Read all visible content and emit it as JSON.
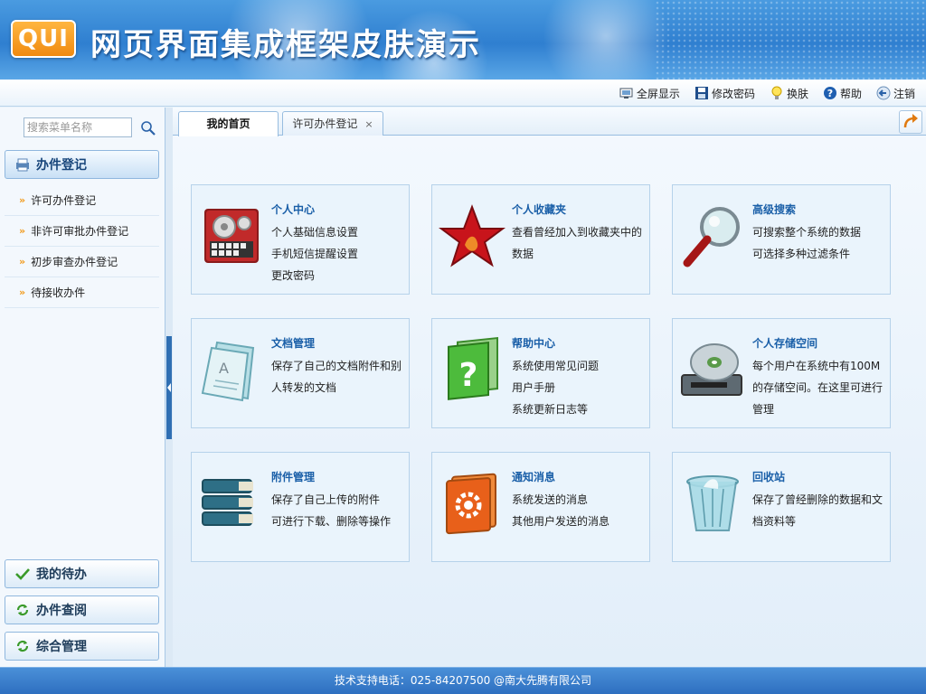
{
  "header": {
    "logo": "QUI",
    "title": "网页界面集成框架皮肤演示"
  },
  "toolbar": [
    {
      "label": "全屏显示",
      "icon": "fullscreen-icon"
    },
    {
      "label": "修改密码",
      "icon": "save-icon"
    },
    {
      "label": "换肤",
      "icon": "lightbulb-icon"
    },
    {
      "label": "帮助",
      "icon": "help-icon"
    },
    {
      "label": "注销",
      "icon": "logout-icon"
    }
  ],
  "sidebar": {
    "search_placeholder": "搜索菜单名称",
    "active_section": "办件登记",
    "items": [
      "许可办件登记",
      "非许可审批办件登记",
      "初步审查办件登记",
      "待接收办件"
    ],
    "sections": [
      "我的待办",
      "办件查阅",
      "综合管理"
    ]
  },
  "tabs": [
    {
      "label": "我的首页"
    },
    {
      "label": "许可办件登记",
      "close": "×"
    }
  ],
  "cards": [
    {
      "title": "个人中心",
      "lines": [
        "个人基础信息设置",
        "手机短信提醒设置",
        "更改密码"
      ],
      "icon": "control-panel-icon"
    },
    {
      "title": "个人收藏夹",
      "lines": [
        "查看曾经加入到收藏夹中的数据"
      ],
      "icon": "star-icon"
    },
    {
      "title": "高级搜索",
      "lines": [
        "可搜索整个系统的数据",
        "可选择多种过滤条件"
      ],
      "icon": "magnifier-icon"
    },
    {
      "title": "文档管理",
      "lines": [
        "保存了自己的文档附件和别人转发的文档"
      ],
      "icon": "document-icon"
    },
    {
      "title": "帮助中心",
      "lines": [
        "系统使用常见问题",
        "用户手册",
        "系统更新日志等"
      ],
      "icon": "help-book-icon"
    },
    {
      "title": "个人存储空间",
      "lines": [
        "每个用户在系统中有100M的存储空间。在这里可进行管理"
      ],
      "icon": "disk-drive-icon"
    },
    {
      "title": "附件管理",
      "lines": [
        "保存了自己上传的附件",
        "可进行下载、删除等操作"
      ],
      "icon": "file-stack-icon"
    },
    {
      "title": "通知消息",
      "lines": [
        "系统发送的消息",
        "其他用户发送的消息"
      ],
      "icon": "gear-book-icon"
    },
    {
      "title": "回收站",
      "lines": [
        "保存了曾经删除的数据和文档资料等"
      ],
      "icon": "recycle-bin-icon"
    }
  ],
  "footer": {
    "text": "技术支持电话：025-84207500 @南大先腾有限公司"
  }
}
